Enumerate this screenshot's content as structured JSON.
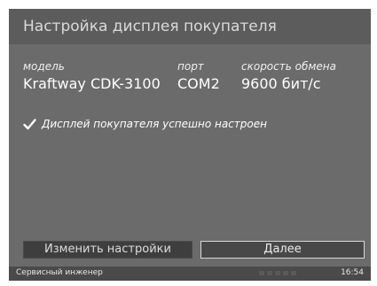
{
  "header": {
    "title": "Настройка дисплея покупателя"
  },
  "device": {
    "model_label": "модель",
    "model_value": "Kraftway CDK-3100",
    "port_label": "порт",
    "port_value": "COM2",
    "speed_label": "скорость обмена",
    "speed_value": "9600 бит/с"
  },
  "status": {
    "icon": "check-icon",
    "message": "Дисплей покупателя успешно настроен"
  },
  "actions": {
    "change_label": "Изменить настройки",
    "next_label": "Далее"
  },
  "status_bar": {
    "user": "Сервисный инженер",
    "time": "16:54"
  },
  "colors": {
    "background": "#6b6b6b",
    "title_bar": "#5c5c5c",
    "button_dark": "#3e3e3e",
    "button_focused_border": "#d8d8d8",
    "status_bar": "#4a4a4a"
  }
}
